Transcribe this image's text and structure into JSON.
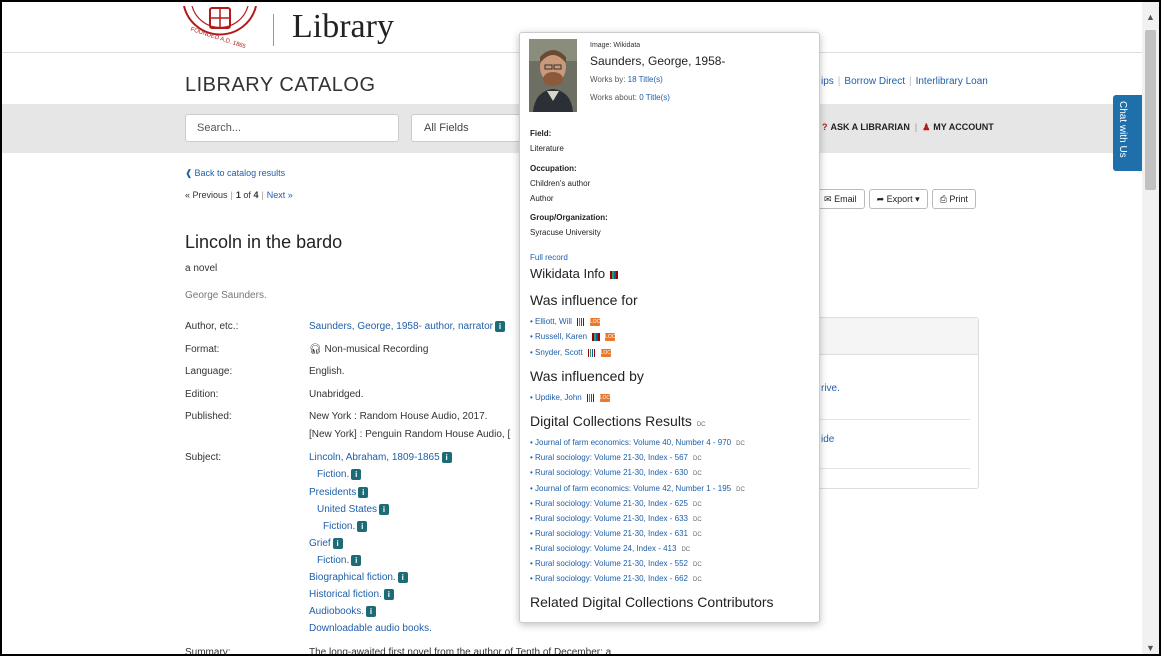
{
  "header": {
    "library_title": "Library",
    "catalog_title": "LIBRARY CATALOG",
    "top_links": [
      "ips",
      "Borrow Direct",
      "Interlibrary Loan"
    ],
    "logo_text": "FOUNDED A.D. 1865"
  },
  "search": {
    "placeholder": "Search...",
    "field_select": "All Fields",
    "ask_librarian": "ASK A LIBRARIAN",
    "my_account": "MY ACCOUNT"
  },
  "chat_tab": "Chat with Us",
  "nav": {
    "back_link": "Back to catalog results",
    "previous": "« Previous",
    "position_prefix": "1",
    "position_of": "of",
    "position_total": "4",
    "next": "Next »"
  },
  "tools": {
    "email": "Email",
    "export": "Export",
    "print": "Print"
  },
  "record": {
    "title": "Lincoln in the bardo",
    "subtitle": "a novel",
    "statement": "George Saunders.",
    "labels": {
      "author": "Author, etc.:",
      "format": "Format:",
      "language": "Language:",
      "edition": "Edition:",
      "published": "Published:",
      "subject": "Subject:",
      "summary": "Summary:"
    },
    "author": "Saunders, George, 1958- author, narrator",
    "format": "Non-musical Recording",
    "language": "English.",
    "edition": "Unabridged.",
    "published": [
      "New York : Random House Audio, 2017.",
      "[New York] : Penguin Random House Audio, ["
    ],
    "subjects": [
      "Lincoln, Abraham, 1809-1865",
      "Fiction.",
      "Presidents",
      "United States",
      "Fiction.",
      "Grief",
      "Fiction.",
      "Biographical fiction.",
      "Historical fiction.",
      "Audiobooks.",
      "Downloadable audio books."
    ],
    "summary": "The long-awaited first novel from the author of Tenth of December: a"
  },
  "side_panel": {
    "link1": "rive.",
    "link2": "ide"
  },
  "popup": {
    "image_credit": "Image: Wikidata",
    "name": "Saunders, George, 1958-",
    "works_by_label": "Works by:",
    "works_by_value": "18 Title(s)",
    "works_about_label": "Works about:",
    "works_about_value": "0 Title(s)",
    "field_label": "Field:",
    "field_value": "Literature",
    "occupation_label": "Occupation:",
    "occupations": [
      "Children's author",
      "Author"
    ],
    "group_label": "Group/Organization:",
    "group_value": "Syracuse University",
    "full_record": "Full record",
    "wikidata_info": "Wikidata Info",
    "influence_for_heading": "Was influence for",
    "influence_for": [
      "• Elliott, Will",
      "• Russell, Karen",
      "• Snyder, Scott"
    ],
    "influenced_by_heading": "Was influenced by",
    "influenced_by": [
      "• Updike, John"
    ],
    "dc_heading": "Digital Collections Results",
    "dc_tag": "DC",
    "loc_tag": "LOC",
    "dc_results": [
      "• Journal of farm economics: Volume 40, Number 4 - 970",
      "• Rural sociology: Volume 21-30, Index - 567",
      "• Rural sociology: Volume 21-30, Index - 630",
      "• Journal of farm economics: Volume 42, Number 1 - 195",
      "• Rural sociology: Volume 21-30, Index - 625",
      "• Rural sociology: Volume 21-30, Index - 633",
      "• Rural sociology: Volume 21-30, Index - 631",
      "• Rural sociology: Volume 24, Index - 413",
      "• Rural sociology: Volume 21-30, Index - 552",
      "• Rural sociology: Volume 21-30, Index - 662"
    ],
    "related_heading": "Related Digital Collections Contributors"
  },
  "icons": {
    "back": "circle-arrow-left-icon",
    "headphones": "headphones-icon",
    "info": "info-icon",
    "question": "question-icon",
    "user": "user-icon",
    "envelope": "envelope-icon",
    "share": "share-icon",
    "print": "print-icon",
    "wikidata": "wikidata-icon",
    "loc": "loc-icon"
  },
  "colors": {
    "link": "#1f5fa8",
    "brand_red": "#b31b1b",
    "chat_tab": "#1f6fab",
    "info_badge": "#1d6b74",
    "band": "#e6e6e6"
  }
}
